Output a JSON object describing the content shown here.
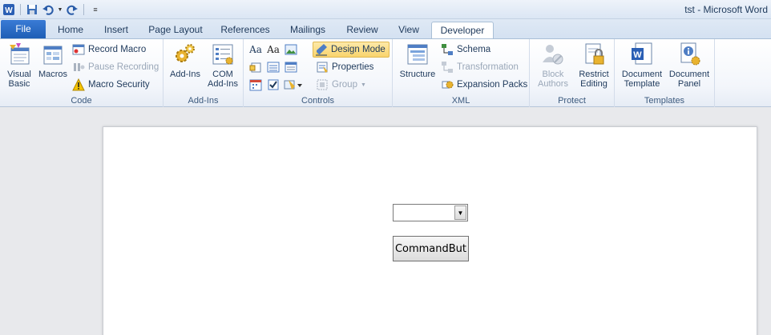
{
  "window": {
    "title": "tst  -  Microsoft Word"
  },
  "tabs": [
    "File",
    "Home",
    "Insert",
    "Page Layout",
    "References",
    "Mailings",
    "Review",
    "View",
    "Developer"
  ],
  "active_tab": "Developer",
  "ribbon": {
    "code": {
      "label": "Code",
      "visual_basic": "Visual\nBasic",
      "macros": "Macros",
      "record_macro": "Record Macro",
      "pause_recording": "Pause Recording",
      "macro_security": "Macro Security"
    },
    "addins": {
      "label": "Add-Ins",
      "add_ins": "Add-Ins",
      "com_add_ins": "COM\nAdd-Ins"
    },
    "controls": {
      "label": "Controls",
      "design_mode": "Design Mode",
      "properties": "Properties",
      "group": "Group"
    },
    "xml": {
      "label": "XML",
      "structure": "Structure",
      "schema": "Schema",
      "transformation": "Transformation",
      "expansion_packs": "Expansion Packs"
    },
    "protect": {
      "label": "Protect",
      "block_authors": "Block\nAuthors",
      "restrict_editing": "Restrict\nEditing"
    },
    "templates": {
      "label": "Templates",
      "document_template": "Document\nTemplate",
      "document_panel": "Document\nPanel"
    }
  },
  "document": {
    "combo_value": "",
    "command_button": "CommandBut"
  },
  "colors": {
    "file_tab": "#2b6cc4",
    "pressed": "#f9d46d",
    "page": "#ffffff"
  }
}
